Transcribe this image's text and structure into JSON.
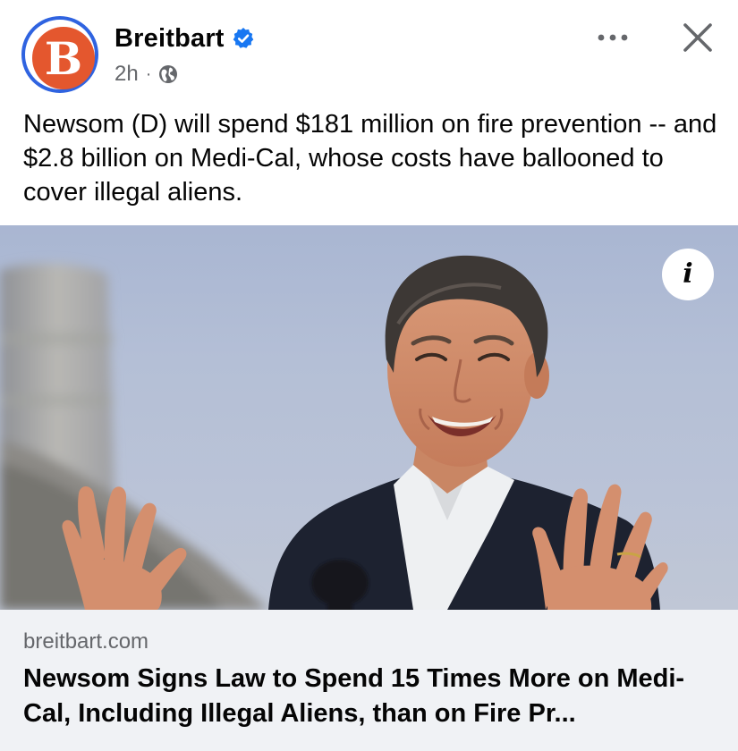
{
  "post": {
    "author": "Breitbart",
    "avatar_letter": "B",
    "verified": true,
    "time": "2h",
    "separator": "·",
    "audience_icon": "globe-icon",
    "more_icon": "more-horizontal-icon",
    "more_label": "•••",
    "close_icon": "close-icon",
    "text": "Newsom (D) will spend $181 million on fire prevention -- and $2.8 billion on Medi-Cal, whose costs have ballooned to cover illegal aliens."
  },
  "link": {
    "info_label": "i",
    "domain": "breitbart.com",
    "title": "Newsom Signs Law to Spend 15 Times More on Medi-Cal, Including Illegal Aliens, than on Fire Pr..."
  },
  "colors": {
    "verified_blue": "#1877f2",
    "avatar_ring": "#2f63e0",
    "avatar_fill": "#e4572e",
    "secondary_text": "#65676b",
    "link_footer_bg": "#f0f2f5"
  }
}
